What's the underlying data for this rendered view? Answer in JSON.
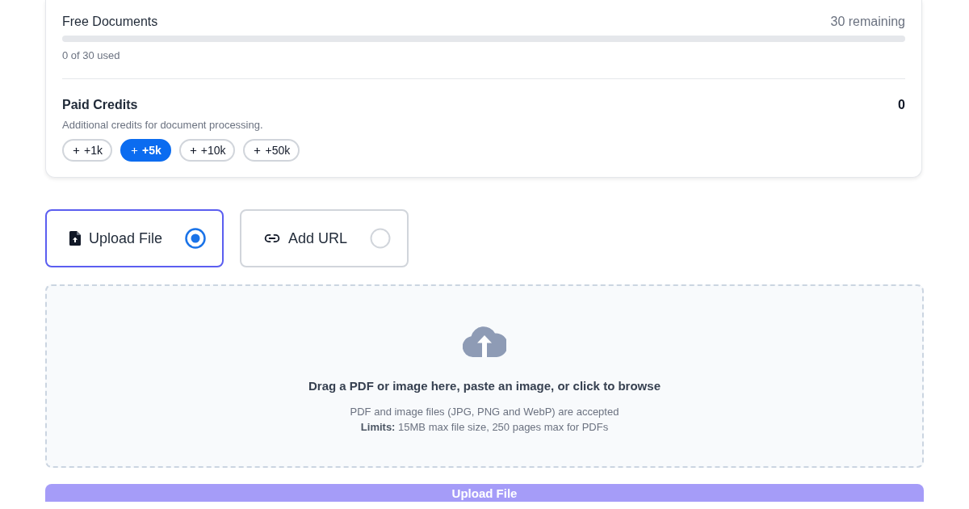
{
  "usage_card": {
    "free_documents": {
      "label": "Free Documents",
      "remaining": "30 remaining",
      "level": 0,
      "used": "0 of 30 used"
    },
    "paid_credits": {
      "label": "Paid Credits",
      "value": "0",
      "description": "Additional credits for document processing.",
      "options": [
        {
          "label": "+1k",
          "selected": false
        },
        {
          "label": "+5k",
          "selected": true
        },
        {
          "label": "+10k",
          "selected": false
        },
        {
          "label": "+50k",
          "selected": false
        }
      ]
    }
  },
  "source_options": [
    {
      "kind": "file",
      "label": "Upload File",
      "selected": true
    },
    {
      "kind": "url",
      "label": "Add URL",
      "selected": false
    }
  ],
  "drop_zone": {
    "title": "Drag a PDF or image here, paste an image, or click to browse",
    "formats": "PDF and image files (JPG, PNG and WebP) are accepted",
    "limits": "**Limits:** 15MB max file size, 250 pages max for PDFs"
  },
  "submit_button": {
    "label": "Upload File",
    "disabled": true
  }
}
